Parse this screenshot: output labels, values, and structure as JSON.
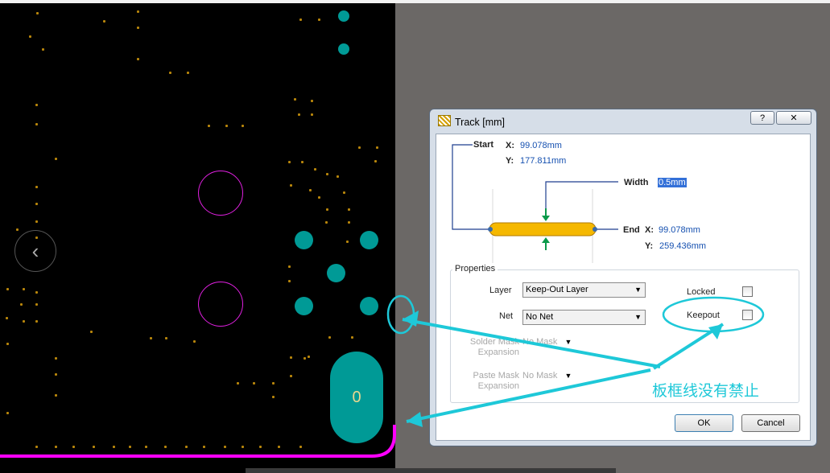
{
  "canvas": {
    "pad_label": "0"
  },
  "dialog": {
    "title": "Track [mm]",
    "help_label": "?",
    "close_label": "✕",
    "start": {
      "label": "Start",
      "x_label": "X:",
      "x_value": "99.078mm",
      "y_label": "Y:",
      "y_value": "177.811mm"
    },
    "width": {
      "label": "Width",
      "value": "0.5mm"
    },
    "end": {
      "label": "End",
      "x_label": "X:",
      "x_value": "99.078mm",
      "y_label": "Y:",
      "y_value": "259.436mm"
    },
    "properties": {
      "group_label": "Properties",
      "layer_label": "Layer",
      "layer_value": "Keep-Out Layer",
      "net_label": "Net",
      "net_value": "No Net",
      "solder_mask_label": "Solder Mask Expansion",
      "solder_mask_value": "No Mask",
      "paste_mask_label": "Paste Mask Expansion",
      "paste_mask_value": "No Mask",
      "locked_label": "Locked",
      "keepout_label": "Keepout"
    },
    "ok_label": "OK",
    "cancel_label": "Cancel"
  },
  "annotation": {
    "text": "板框线没有禁止",
    "color": "#1ec8d8"
  },
  "colors": {
    "pad": "#009a96",
    "board_outline": "#ff00ff",
    "track": "#f5b800"
  }
}
